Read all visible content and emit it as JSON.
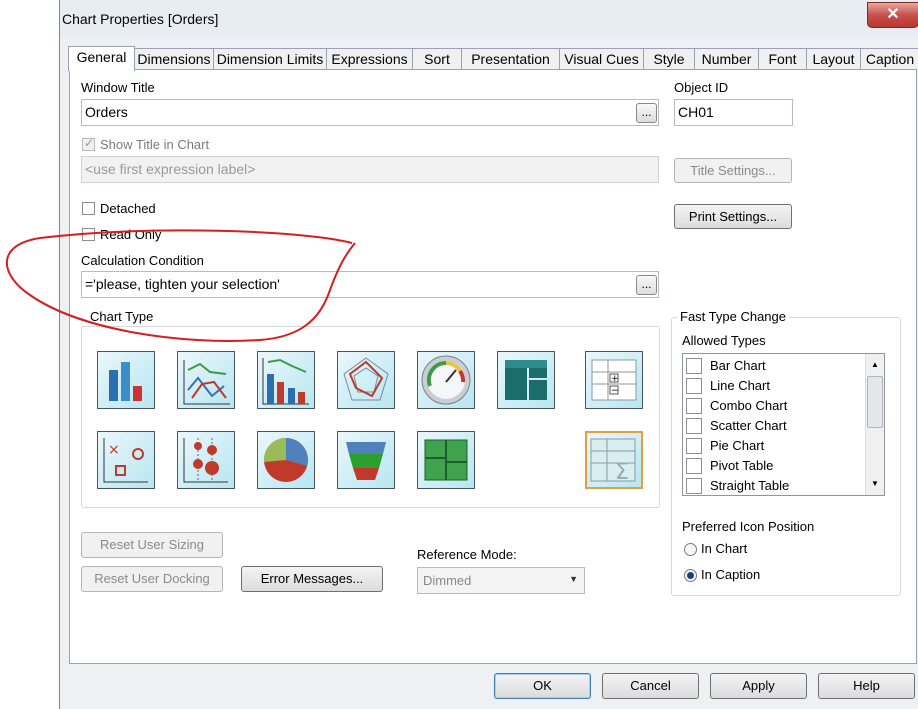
{
  "window": {
    "title": "Chart Properties [Orders]",
    "close_glyph": "✕"
  },
  "tabs": [
    {
      "label": "General"
    },
    {
      "label": "Dimensions"
    },
    {
      "label": "Dimension Limits"
    },
    {
      "label": "Expressions"
    },
    {
      "label": "Sort"
    },
    {
      "label": "Presentation"
    },
    {
      "label": "Visual Cues"
    },
    {
      "label": "Style"
    },
    {
      "label": "Number"
    },
    {
      "label": "Font"
    },
    {
      "label": "Layout"
    },
    {
      "label": "Caption"
    }
  ],
  "general": {
    "window_title_label": "Window Title",
    "window_title_value": "Orders",
    "object_id_label": "Object ID",
    "object_id_value": "CH01",
    "show_title_label": "Show Title in Chart",
    "title_placeholder": "<use first expression label>",
    "title_settings_label": "Title Settings...",
    "print_settings_label": "Print Settings...",
    "detached_label": "Detached",
    "read_only_label": "Read Only",
    "calc_condition_label": "Calculation Condition",
    "calc_condition_value": "='please, tighten your selection'",
    "ellipsis": "...",
    "chart_type_label": "Chart Type",
    "fast_type_label": "Fast Type Change",
    "allowed_types_label": "Allowed Types",
    "allowed_types": [
      "Bar Chart",
      "Line Chart",
      "Combo Chart",
      "Scatter Chart",
      "Pie Chart",
      "Pivot Table",
      "Straight Table"
    ],
    "preferred_icon_label": "Preferred Icon Position",
    "in_chart_label": "In Chart",
    "in_caption_label": "In Caption",
    "reset_sizing_label": "Reset User Sizing",
    "reset_docking_label": "Reset User Docking",
    "error_messages_label": "Error Messages...",
    "reference_mode_label": "Reference Mode:",
    "reference_mode_value": "Dimmed"
  },
  "footer": {
    "ok": "OK",
    "cancel": "Cancel",
    "apply": "Apply",
    "help": "Help"
  },
  "colors": {
    "annotation": "#d42020",
    "accent": "#1b3f7a"
  }
}
